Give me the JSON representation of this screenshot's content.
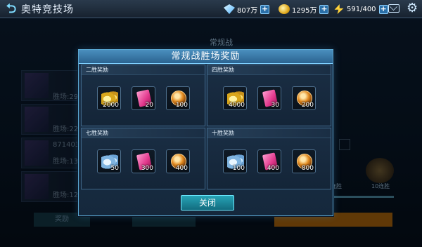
{
  "header": {
    "title": "奥特竞技场",
    "diamonds": "807万",
    "coins": "1295万",
    "energy": "591/400"
  },
  "background": {
    "mode_label": "常规战",
    "ranks": [
      {
        "name": "",
        "wins": "胜场:29"
      },
      {
        "name": "",
        "wins": "胜场:22"
      },
      {
        "name": "871403",
        "wins": "胜场:13"
      },
      {
        "name": "",
        "wins": "胜场:12"
      }
    ],
    "trophy_label": "10连胜",
    "win_label": "连胜",
    "button_left": "奖励"
  },
  "modal": {
    "title": "常规战胜场奖励",
    "close_label": "关闭",
    "panels": [
      {
        "title": "二胜奖励",
        "items": [
          {
            "icon": "gold-coins",
            "count": "2000"
          },
          {
            "icon": "pink-book",
            "count": "20"
          },
          {
            "icon": "bronze-medal",
            "count": "100"
          }
        ]
      },
      {
        "title": "四胜奖励",
        "items": [
          {
            "icon": "gold-coins",
            "count": "4000"
          },
          {
            "icon": "pink-book",
            "count": "30"
          },
          {
            "icon": "bronze-medal",
            "count": "200"
          }
        ]
      },
      {
        "title": "七胜奖励",
        "items": [
          {
            "icon": "silver-coins",
            "count": "50"
          },
          {
            "icon": "pink-book",
            "count": "300"
          },
          {
            "icon": "bronze-medal",
            "count": "400"
          }
        ]
      },
      {
        "title": "十胜奖励",
        "items": [
          {
            "icon": "silver-coins",
            "count": "100"
          },
          {
            "icon": "pink-book",
            "count": "400"
          },
          {
            "icon": "bronze-medal",
            "count": "800"
          }
        ]
      }
    ]
  }
}
